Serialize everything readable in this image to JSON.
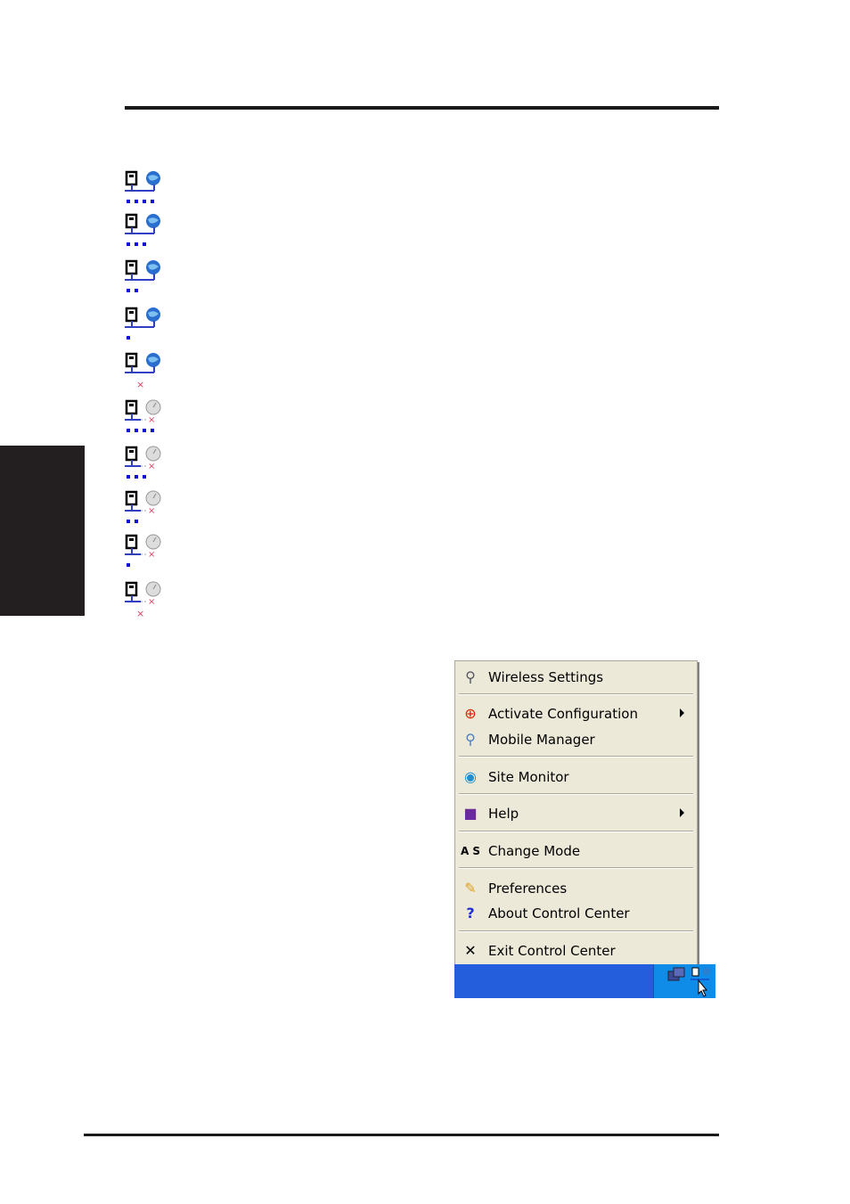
{
  "status_icons": [
    {
      "state": "connected",
      "signal_bars": 4
    },
    {
      "state": "connected",
      "signal_bars": 3
    },
    {
      "state": "connected",
      "signal_bars": 2
    },
    {
      "state": "connected",
      "signal_bars": 1
    },
    {
      "state": "connected",
      "signal_bars": 0
    },
    {
      "state": "disconnected",
      "signal_bars": 4
    },
    {
      "state": "disconnected",
      "signal_bars": 3
    },
    {
      "state": "disconnected",
      "signal_bars": 2
    },
    {
      "state": "disconnected",
      "signal_bars": 1
    },
    {
      "state": "disconnected",
      "signal_bars": 0
    }
  ],
  "menu": {
    "items": [
      {
        "label": "Wireless Settings",
        "icon": "antenna-icon"
      },
      {
        "label": "Activate Configuration",
        "icon": "target-icon",
        "submenu": true
      },
      {
        "label": "Mobile Manager",
        "icon": "antenna-icon"
      },
      {
        "label": "Site Monitor",
        "icon": "site-monitor-icon"
      },
      {
        "label": "Help",
        "icon": "book-icon",
        "submenu": true
      },
      {
        "label": "Change Mode",
        "icon": "change-mode-icon",
        "icon_text": "A S"
      },
      {
        "label": "Preferences",
        "icon": "pencil-icon"
      },
      {
        "label": "About Control Center",
        "icon": "question-icon"
      },
      {
        "label": "Exit Control Center",
        "icon": "close-icon"
      }
    ]
  },
  "colors": {
    "taskbar": "#245edc",
    "tray": "#0f8be8",
    "menu_bg": "#ece9d8",
    "side_tab": "#231f20"
  }
}
